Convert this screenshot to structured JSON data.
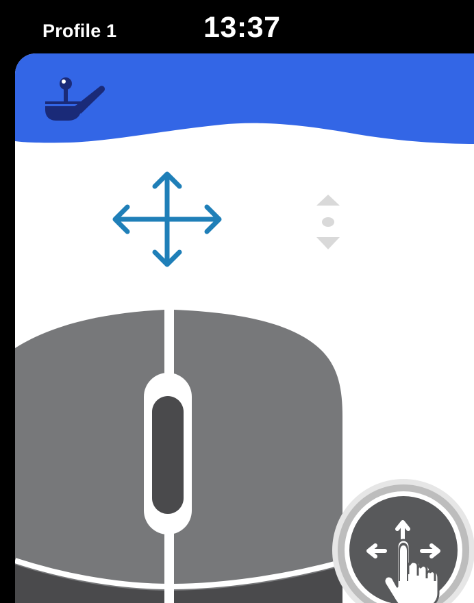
{
  "status_bar": {
    "profile_label": "Profile 1",
    "time": "13:37"
  },
  "header": {
    "icon": "joystick-icon",
    "color": "#3366e6"
  },
  "modes": {
    "selected": "move",
    "items": [
      {
        "name": "move",
        "icon": "four-way-arrows-icon",
        "active": true,
        "color": "#1f7fb8"
      },
      {
        "name": "scroll",
        "icon": "scroll-arrows-icon",
        "active": false,
        "color": "#d9d9d9"
      }
    ]
  },
  "mouse": {
    "icon": "mouse-icon",
    "body_color": "#77787a",
    "wheel_color": "#4a4a4c"
  },
  "fab": {
    "icon": "touch-move-icon"
  }
}
